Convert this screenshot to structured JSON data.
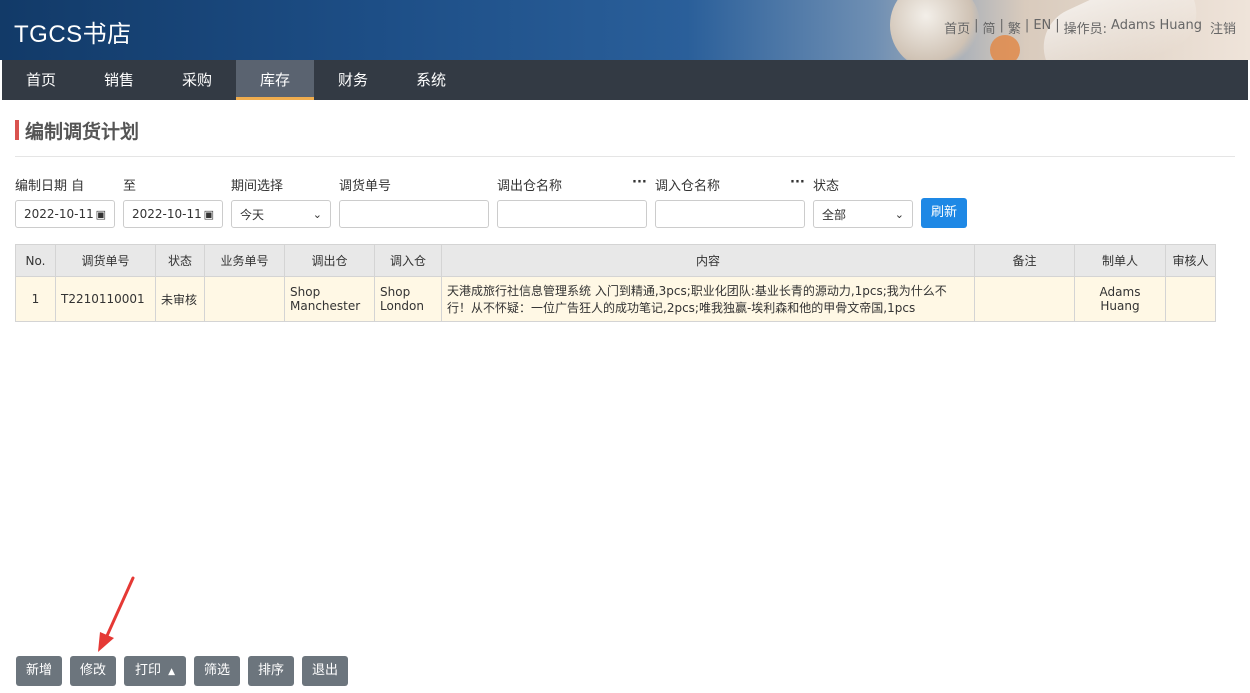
{
  "app": {
    "title": "TGCS书店"
  },
  "toplinks": [
    "首页",
    "|",
    "简",
    "|",
    "繁",
    "|",
    "EN",
    "|",
    "操作员:",
    "Adams Huang",
    "注销"
  ],
  "nav": {
    "items": [
      "首页",
      "销售",
      "采购",
      "库存",
      "财务",
      "系统"
    ],
    "active_index": 3,
    "active_color": "#f0ad4e"
  },
  "page": {
    "title": "编制调货计划"
  },
  "filters": {
    "date_from_label": "编制日期 自",
    "date_to_label": "至",
    "period_label": "期间选择",
    "order_no_label": "调货单号",
    "out_store_label": "调出仓名称",
    "in_store_label": "调入仓名称",
    "status_label": "状态",
    "dots": "···",
    "date_from": "2022-10-11",
    "date_to": "2022-10-11",
    "period_value": "今天",
    "status_value": "全部",
    "refresh_label": "刷新",
    "refresh_color": "#1e88e5"
  },
  "table": {
    "columns": [
      "No.",
      "调货单号",
      "状态",
      "业务单号",
      "调出仓",
      "调入仓",
      "内容",
      "备注",
      "制单人",
      "审核人"
    ],
    "rows": [
      {
        "no": "1",
        "order_no": "T2210110001",
        "status": "未审核",
        "biz_no": "",
        "out_store": "Shop Manchester",
        "in_store": "Shop London",
        "content": "天港成旅行社信息管理系统 入门到精通,3pcs;职业化团队:基业长青的源动力,1pcs;我为什么不行！从不怀疑：一位广告狂人的成功笔记,2pcs;唯我独赢-埃利森和他的甲骨文帝国,1pcs",
        "remark": "",
        "creator": "Adams Huang",
        "auditor": ""
      }
    ]
  },
  "buttons": {
    "add": "新增",
    "edit": "修改",
    "print": "打印",
    "filter": "筛选",
    "sort": "排序",
    "exit": "退出"
  },
  "annotation_color": "#e53935"
}
